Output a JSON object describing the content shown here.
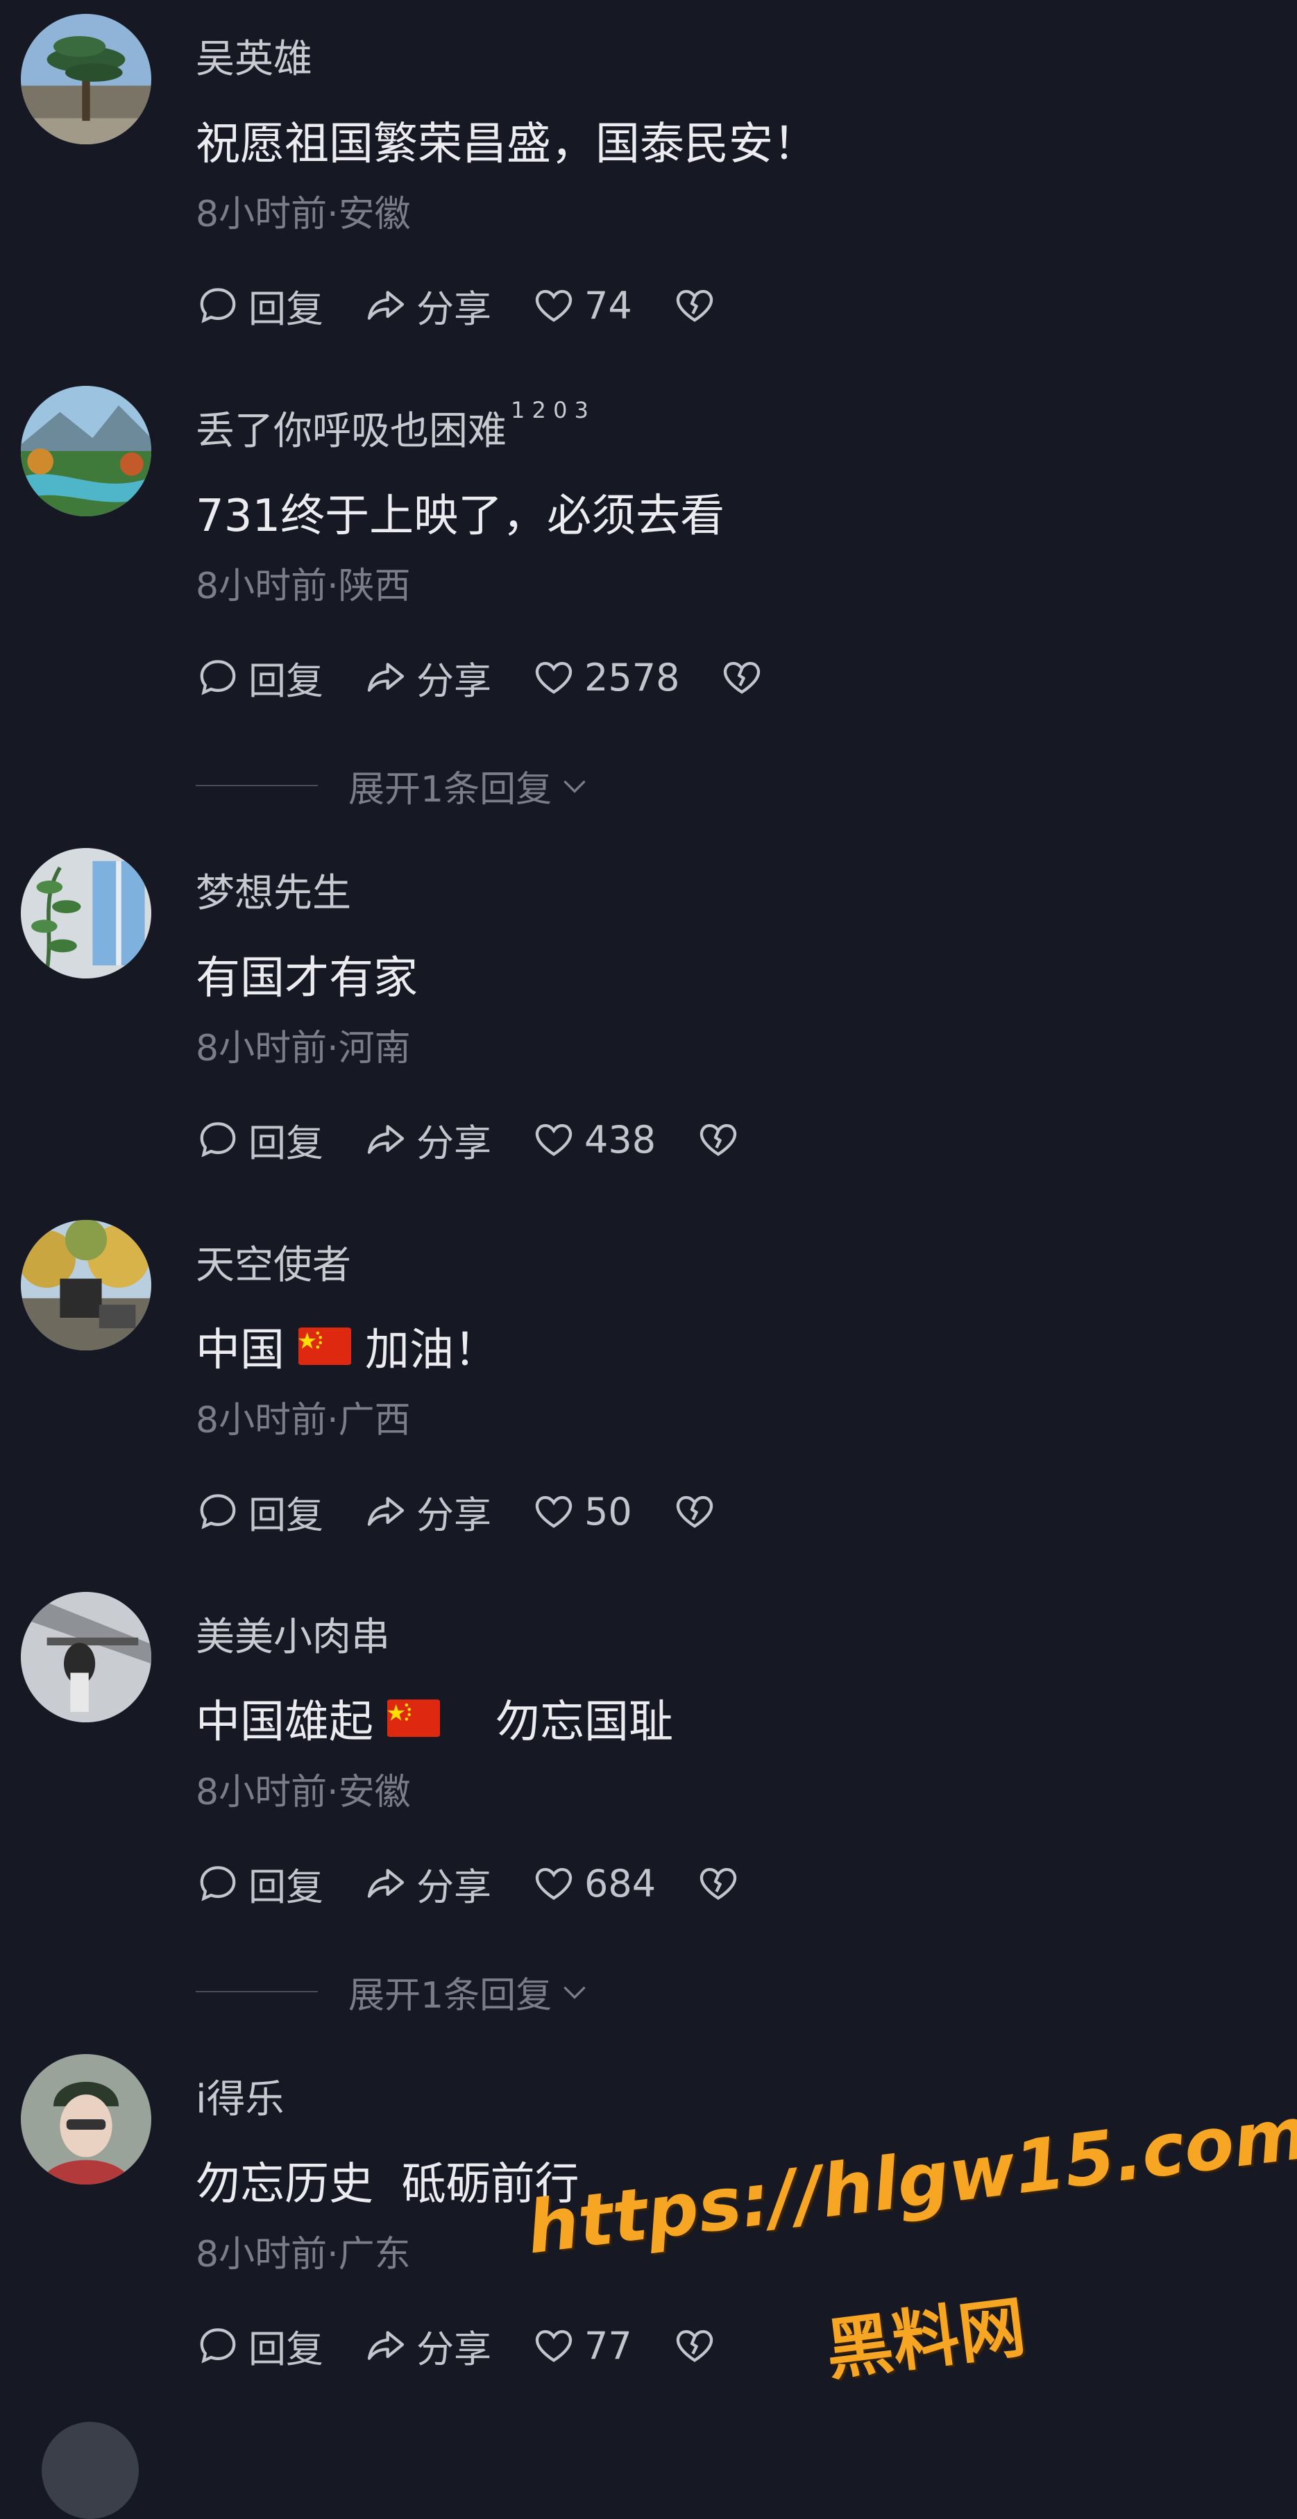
{
  "labels": {
    "reply": "回复",
    "share": "分享",
    "expand_replies": "展开1条回复"
  },
  "colors": {
    "background": "#161823",
    "text_primary": "#ececf0",
    "text_secondary": "#7b7d88",
    "watermark": "#f6a623",
    "flag_red": "#de2910"
  },
  "comments": [
    {
      "username": "吴英雄",
      "content": "祝愿祖国繁荣昌盛，国泰民安！",
      "time": "8小时前",
      "location": "安徽",
      "likes": "74",
      "avatar_icon": "pine-tree-landscape-avatar"
    },
    {
      "username": "丢了你呼吸也困难",
      "username_sup": "1 2 0 3",
      "content": "731终于上映了，必须去看",
      "time": "8小时前",
      "location": "陕西",
      "likes": "2578",
      "avatar_icon": "river-landscape-avatar"
    },
    {
      "username": "梦想先生",
      "content": "有国才有家",
      "time": "8小时前",
      "location": "河南",
      "likes": "438",
      "avatar_icon": "plant-window-avatar"
    },
    {
      "username": "天空使者",
      "content_before_flag": "中国",
      "content_after_flag": "加油！",
      "time": "8小时前",
      "location": "广西",
      "likes": "50",
      "avatar_icon": "autumn-trees-avatar"
    },
    {
      "username": "美美小肉串",
      "content_before_flag": "中国雄起",
      "content_after_flag": "勿忘国耻",
      "time": "8小时前",
      "location": "安徽",
      "likes": "684",
      "avatar_icon": "person-photo-avatar"
    },
    {
      "username": "i得乐",
      "content": "勿忘历史  砥砺前行",
      "time": "8小时前",
      "location": "广东",
      "likes": "77",
      "avatar_icon": "person-cap-avatar"
    }
  ],
  "watermark": {
    "url": "https://hlgw15.com",
    "name": "黑料网"
  }
}
